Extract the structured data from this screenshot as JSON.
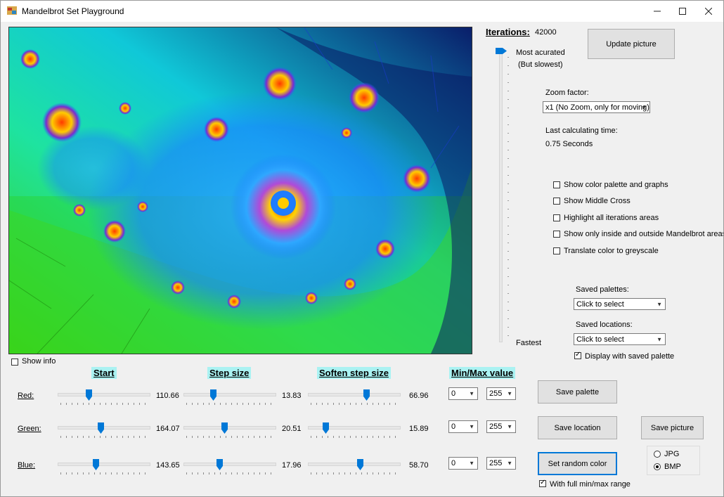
{
  "window": {
    "title": "Mandelbrot Set Playground"
  },
  "iterations": {
    "label": "Iterations:",
    "value": "42000",
    "most_label": "Most acurated",
    "most_sub": "(But slowest)",
    "fastest_label": "Fastest",
    "slider_fraction": 1.0
  },
  "buttons": {
    "update_picture": "Update picture",
    "save_palette": "Save  palette",
    "save_location": "Save location",
    "save_picture": "Save picture",
    "set_random_color": "Set random color"
  },
  "zoom": {
    "label": "Zoom factor:",
    "value": "x1 (No Zoom, only for moving)"
  },
  "calc": {
    "label": "Last calculating time:",
    "value": "0.75 Seconds"
  },
  "options": [
    {
      "label": "Show color palette and graphs",
      "checked": false
    },
    {
      "label": "Show Middle Cross",
      "checked": false
    },
    {
      "label": "Highlight all iterations areas",
      "checked": false
    },
    {
      "label": "Show only inside and outside Mandelbrot areas",
      "checked": false
    },
    {
      "label": "Translate color to greyscale",
      "checked": false
    }
  ],
  "saved_palettes": {
    "label": "Saved palettes:",
    "value": "Click to select"
  },
  "saved_locations": {
    "label": "Saved locations:",
    "value": "Click to select"
  },
  "display_saved_palette": {
    "label": "Display with saved palette",
    "checked": true
  },
  "show_info": {
    "label": "Show info",
    "checked": false
  },
  "headers": {
    "start": "Start",
    "step": "Step size",
    "soften": "Soften step size",
    "minmax": "Min/Max value"
  },
  "channels": [
    {
      "name": "Red:",
      "start": "110.66",
      "start_pos": 0.33,
      "step": "13.83",
      "step_pos": 0.31,
      "soften": "66.96",
      "soften_pos": 0.65,
      "min": "0",
      "max": "255"
    },
    {
      "name": "Green:",
      "start": "164.07",
      "start_pos": 0.47,
      "step": "20.51",
      "step_pos": 0.45,
      "soften": "15.89",
      "soften_pos": 0.17,
      "min": "0",
      "max": "255"
    },
    {
      "name": "Blue:",
      "start": "143.65",
      "start_pos": 0.41,
      "step": "17.96",
      "step_pos": 0.39,
      "soften": "58.70",
      "soften_pos": 0.58,
      "min": "0",
      "max": "255"
    }
  ],
  "full_range": {
    "label": "With full min/max range",
    "checked": true
  },
  "format": {
    "options": [
      "JPG",
      "BMP"
    ],
    "selected": "BMP"
  }
}
